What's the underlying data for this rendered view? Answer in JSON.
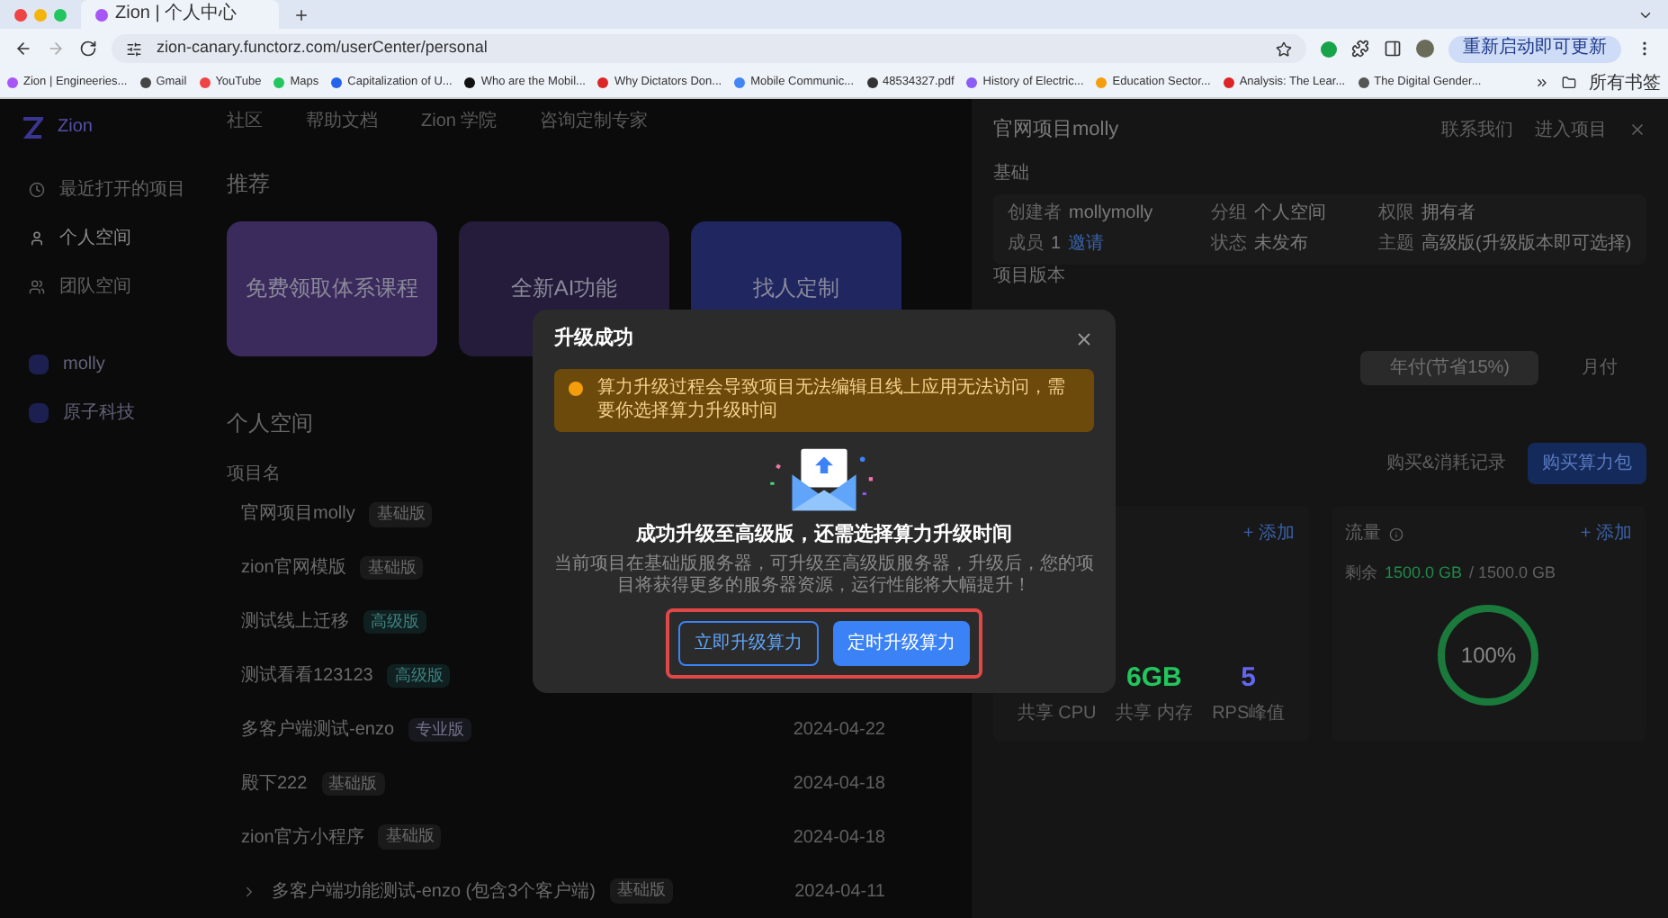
{
  "browser": {
    "tab_title": "Zion | 个人中心",
    "url": "zion-canary.functorz.com/userCenter/personal",
    "update_button": "重新启动即可更新",
    "all_bookmarks": "所有书签",
    "bookmarks": [
      {
        "label": "Zion | Engineeries...",
        "color": "#a855f7"
      },
      {
        "label": "Gmail",
        "color": "#444444"
      },
      {
        "label": "YouTube",
        "color": "#ef4444"
      },
      {
        "label": "Maps",
        "color": "#22c55e"
      },
      {
        "label": "Capitalization of U...",
        "color": "#2563eb"
      },
      {
        "label": "Who are the Mobil...",
        "color": "#111111"
      },
      {
        "label": "Why Dictators Don...",
        "color": "#dc2626"
      },
      {
        "label": "Mobile Communic...",
        "color": "#4285f4"
      },
      {
        "label": "48534327.pdf",
        "color": "#333333"
      },
      {
        "label": "History of Electric...",
        "color": "#8b5cf6"
      },
      {
        "label": "Education Sector...",
        "color": "#f59e0b"
      },
      {
        "label": "Analysis: The Lear...",
        "color": "#dc2626"
      },
      {
        "label": "The Digital Gender...",
        "color": "#555555"
      }
    ]
  },
  "sidebar": {
    "logo": "Zion",
    "items": [
      {
        "label": "最近打开的项目",
        "kind": "recent",
        "selected": false
      },
      {
        "label": "个人空间",
        "kind": "personal",
        "selected": true
      },
      {
        "label": "团队空间",
        "kind": "team",
        "selected": false
      }
    ],
    "spaces": [
      {
        "label": "molly"
      },
      {
        "label": "原子科技"
      }
    ]
  },
  "top_nav": [
    "社区",
    "帮助文档",
    "Zion 学院",
    "咨询定制专家"
  ],
  "recommend": {
    "title": "推荐",
    "cards": [
      {
        "label": "免费领取体系课程",
        "color": "#3b2a5c"
      },
      {
        "label": "全新AI功能",
        "color": "#241c3a"
      },
      {
        "label": "找人定制",
        "color": "#1f2660"
      }
    ]
  },
  "personal": {
    "title": "个人空间",
    "column": "项目名",
    "rows": [
      {
        "name": "官网项目molly",
        "badge": "基础版",
        "kind": "basic",
        "expandable": false
      },
      {
        "name": "zion官网模版",
        "badge": "基础版",
        "kind": "basic",
        "expandable": false
      },
      {
        "name": "测试线上迁移",
        "badge": "高级版",
        "kind": "advanced",
        "expandable": false
      },
      {
        "name": "测试看看123123",
        "badge": "高级版",
        "kind": "advanced",
        "expandable": false
      },
      {
        "name": "多客户端测试-enzo",
        "badge": "专业版",
        "kind": "pro",
        "date": "2024-04-22",
        "expandable": false
      },
      {
        "name": "殿下222",
        "badge": "基础版",
        "kind": "basic",
        "date": "2024-04-18",
        "expandable": false
      },
      {
        "name": "zion官方小程序",
        "badge": "基础版",
        "kind": "basic",
        "date": "2024-04-18",
        "expandable": false
      },
      {
        "name": "多客户端功能测试-enzo (包含3个客户端)",
        "badge": "基础版",
        "kind": "basic",
        "date": "2024-04-11",
        "expandable": true
      }
    ]
  },
  "drawer": {
    "title": "官网项目molly",
    "actions": [
      "联系我们",
      "进入项目"
    ],
    "section": "基础",
    "info": [
      {
        "label": "创建者",
        "value": "mollymolly"
      },
      {
        "label": "分组",
        "value": "个人空间"
      },
      {
        "label": "权限",
        "value": "拥有者"
      },
      {
        "label": "成员",
        "value": "1",
        "link": "邀请"
      },
      {
        "label": "状态",
        "value": "未发布"
      },
      {
        "label": "主题",
        "value": "高级版(升级版本即可选择)"
      }
    ],
    "version_title": "项目版本",
    "billing_tabs": [
      {
        "label": "年付(节省15%)",
        "selected": true
      },
      {
        "label": "月付",
        "selected": false
      }
    ],
    "records_link": "购买&消耗记录",
    "buy_button": "购买算力包",
    "resources": [
      {
        "add": "+ 添加",
        "stats": [
          {
            "label": "共享 CPU"
          },
          {
            "value": "6GB",
            "label": "共享 内存",
            "color": "#22c55e"
          },
          {
            "value": "5",
            "label": "RPS峰值",
            "color": "#6366f1"
          }
        ]
      },
      {
        "title": "流量",
        "add": "+ 添加",
        "remain": "剩余",
        "amount": "1500.0 GB",
        "total": "/ 1500.0 GB",
        "percent": "100%",
        "level": 1
      }
    ]
  },
  "modal": {
    "title": "升级成功",
    "warning": "算力升级过程会导致项目无法编辑且线上应用无法访问，需要你选择算力升级时间",
    "heading": "成功升级至高级版，还需选择算力升级时间",
    "description": "当前项目在基础版服务器，可升级至高级版服务器，升级后，您的项目将获得更多的服务器资源，运行性能将大幅提升！",
    "buttons": [
      {
        "label": "立即升级算力",
        "kind": "outline"
      },
      {
        "label": "定时升级算力",
        "kind": "primary"
      }
    ],
    "highlighted": true
  }
}
